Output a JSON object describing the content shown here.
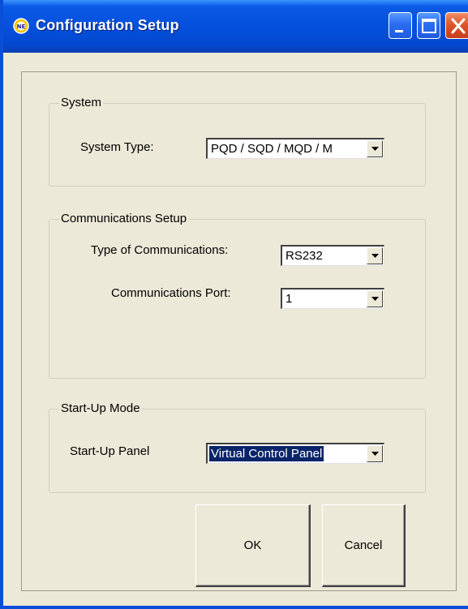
{
  "window": {
    "title": "Configuration Setup",
    "app_icon": "npe-logo-icon",
    "controls": [
      "minimize-icon",
      "maximize-icon",
      "close-icon"
    ],
    "colors": {
      "titlebar": "#0550dc",
      "close": "#e0552a",
      "background": "#ece9d8"
    }
  },
  "system": {
    "legend": "System",
    "system_type_label": "System Type:",
    "system_type_value": "PQD / SQD / MQD / M"
  },
  "communications": {
    "legend": "Communications Setup",
    "type_label": "Type of Communications:",
    "type_value": "RS232",
    "port_label": "Communications Port:",
    "port_value": "1"
  },
  "startup": {
    "legend": "Start-Up Mode",
    "panel_label": "Start-Up Panel",
    "panel_value": "Virtual Control Panel"
  },
  "buttons": {
    "ok_label": "OK",
    "cancel_label": "Cancel"
  }
}
